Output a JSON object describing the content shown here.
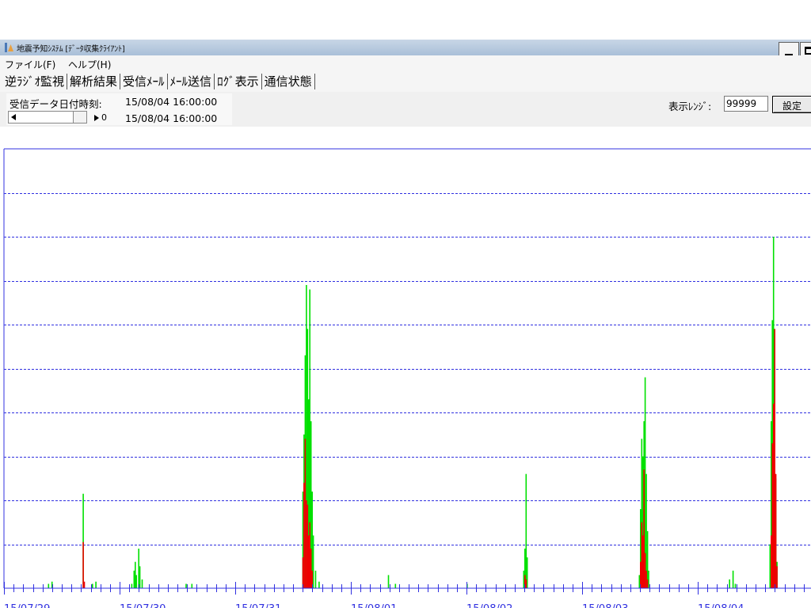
{
  "window": {
    "title": "地震予知ｼｽﾃﾑ [ﾃﾞｰﾀ収集ｸﾗｲｱﾝﾄ]"
  },
  "menu": [
    {
      "label": "ファイル(F)"
    },
    {
      "label": "ヘルプ(H)"
    }
  ],
  "tabs": [
    {
      "label": "逆ﾗｼﾞｵ監視"
    },
    {
      "label": "解析結果"
    },
    {
      "label": "受信ﾒｰﾙ"
    },
    {
      "label": "ﾒｰﾙ送信"
    },
    {
      "label": "ﾛｸﾞ表示"
    },
    {
      "label": "通信状態"
    }
  ],
  "info": {
    "received_label": "受信データ日付時刻:",
    "received_datetime": "15/08/04 16:00:00",
    "slider_value": "0",
    "slider_datetime": "15/08/04 16:00:00",
    "range_label": "表示ﾚﾝｼﾞ:",
    "range_value": "99999",
    "set_button": "設定"
  },
  "colors": {
    "axis": "#3030e0",
    "gridline": "#3030e0",
    "series_green": "#00e000",
    "series_red": "#ee0000"
  },
  "chart_data": {
    "type": "bar",
    "title": "",
    "xlabel": "",
    "ylabel": "",
    "x_tick_labels": [
      "15/07/29",
      "15/07/30",
      "15/07/31",
      "15/08/01",
      "15/08/02",
      "15/08/03",
      "15/08/04"
    ],
    "x_range_days": [
      0,
      7.1
    ],
    "y_range": [
      0,
      10
    ],
    "gridlines": 10,
    "grid": true,
    "series": [
      {
        "color": "green",
        "points": [
          [
            0.38,
            0.1
          ],
          [
            0.41,
            0.15
          ],
          [
            0.68,
            2.15
          ],
          [
            0.76,
            0.1
          ],
          [
            0.79,
            0.15
          ],
          [
            1.1,
            0.1
          ],
          [
            1.12,
            0.4
          ],
          [
            1.13,
            0.6
          ],
          [
            1.14,
            0.3
          ],
          [
            1.16,
            0.9
          ],
          [
            1.17,
            0.5
          ],
          [
            1.19,
            0.2
          ],
          [
            1.57,
            0.1
          ],
          [
            1.62,
            0.1
          ],
          [
            2.58,
            2.2
          ],
          [
            2.59,
            3.5
          ],
          [
            2.6,
            5.3
          ],
          [
            2.61,
            6.9
          ],
          [
            2.62,
            5.9
          ],
          [
            2.63,
            4.3
          ],
          [
            2.64,
            6.8
          ],
          [
            2.65,
            3.8
          ],
          [
            2.66,
            2.2
          ],
          [
            2.67,
            1.2
          ],
          [
            2.69,
            0.4
          ],
          [
            2.72,
            0.15
          ],
          [
            3.32,
            0.3
          ],
          [
            3.38,
            0.1
          ],
          [
            4.0,
            0.1
          ],
          [
            4.49,
            0.4
          ],
          [
            4.5,
            0.9
          ],
          [
            4.51,
            2.6
          ],
          [
            4.52,
            0.7
          ],
          [
            5.49,
            0.3
          ],
          [
            5.5,
            1.8
          ],
          [
            5.51,
            3.4
          ],
          [
            5.52,
            3.0
          ],
          [
            5.53,
            3.8
          ],
          [
            5.54,
            4.8
          ],
          [
            5.55,
            2.6
          ],
          [
            5.56,
            1.3
          ],
          [
            5.57,
            0.4
          ],
          [
            6.27,
            0.2
          ],
          [
            6.3,
            0.4
          ],
          [
            6.32,
            0.1
          ],
          [
            6.62,
            1.0
          ],
          [
            6.63,
            3.8
          ],
          [
            6.64,
            6.1
          ],
          [
            6.65,
            8.0
          ],
          [
            6.66,
            5.2
          ],
          [
            6.67,
            2.5
          ],
          [
            6.68,
            0.6
          ]
        ]
      },
      {
        "color": "red",
        "points": [
          [
            0.68,
            1.05
          ],
          [
            0.69,
            0.15
          ],
          [
            2.58,
            0.7
          ],
          [
            2.59,
            2.4
          ],
          [
            2.6,
            3.4
          ],
          [
            2.61,
            2.0
          ],
          [
            2.62,
            1.9
          ],
          [
            2.63,
            1.2
          ],
          [
            2.64,
            1.5
          ],
          [
            2.65,
            0.9
          ],
          [
            2.66,
            0.4
          ],
          [
            4.5,
            0.3
          ],
          [
            4.51,
            0.2
          ],
          [
            5.5,
            0.6
          ],
          [
            5.51,
            1.5
          ],
          [
            5.52,
            1.2
          ],
          [
            5.53,
            2.7
          ],
          [
            5.54,
            0.8
          ],
          [
            5.55,
            0.4
          ],
          [
            5.56,
            0.2
          ],
          [
            6.63,
            1.2
          ],
          [
            6.64,
            3.3
          ],
          [
            6.65,
            4.2
          ],
          [
            6.66,
            5.9
          ],
          [
            6.67,
            2.6
          ],
          [
            6.68,
            0.5
          ]
        ]
      }
    ]
  }
}
